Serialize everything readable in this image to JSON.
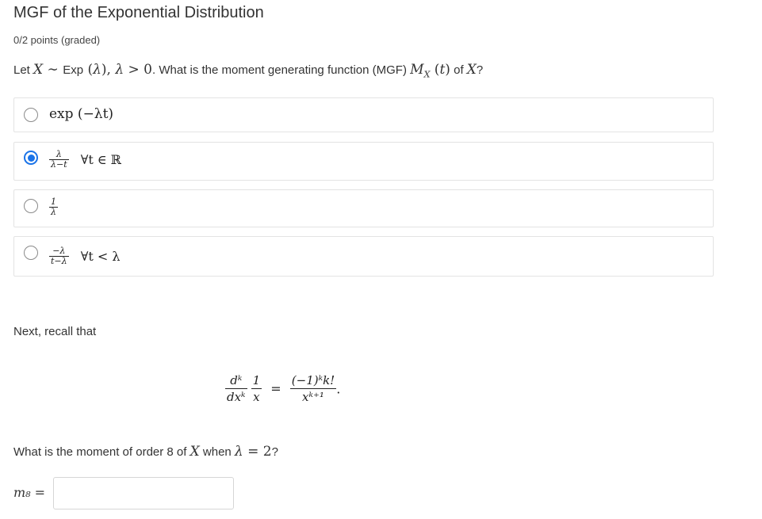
{
  "title": "MGF of the Exponential Distribution",
  "points": "0/2 points (graded)",
  "question": {
    "prefix": "Let",
    "mid": ". What is the moment generating function (MGF)",
    "of": "of",
    "end": "?"
  },
  "options": [
    {
      "label": "exp (−λt)",
      "selected": false
    },
    {
      "num": "λ",
      "den": "λ−t",
      "condition": "∀t ∈ ℝ",
      "selected": true
    },
    {
      "num": "1",
      "den": "λ",
      "condition": "",
      "selected": false
    },
    {
      "num": "−λ",
      "den": "t−λ",
      "condition": "∀t < λ",
      "selected": false
    }
  ],
  "recall_text": "Next, recall that",
  "formula": {
    "lhs_num": "dᵏ",
    "lhs_den": "dxᵏ",
    "lhs2_num": "1",
    "lhs2_den": "x",
    "eq": "=",
    "rhs_num": "(−1)ᵏk!",
    "rhs_den": "xᵏ⁺¹",
    "end": "."
  },
  "moment_question": {
    "prefix": "What is the moment of order 8 of",
    "mid": "when",
    "end": "?"
  },
  "answer": {
    "label": "m₈ =",
    "value": "",
    "placeholder": ""
  }
}
